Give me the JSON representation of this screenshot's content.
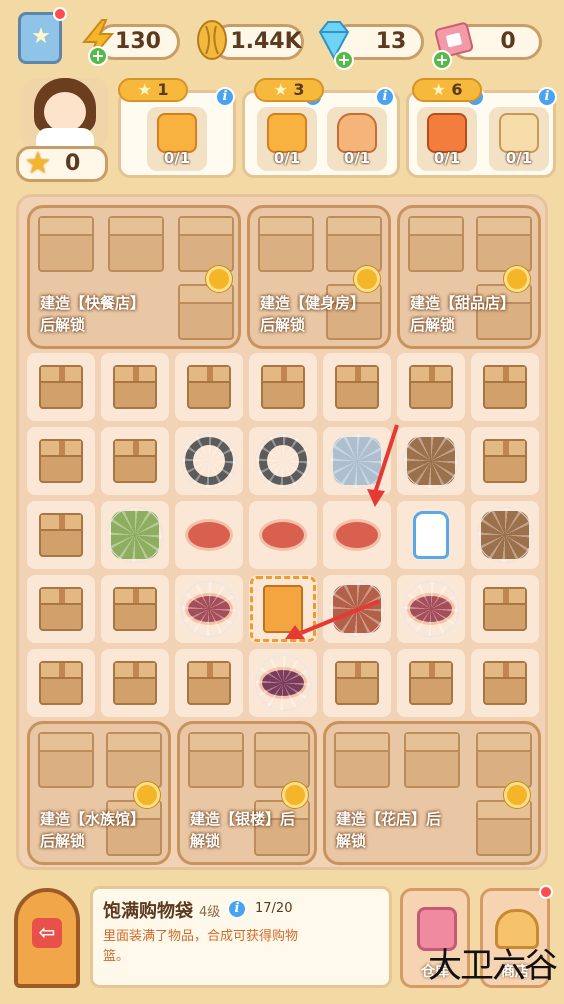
{
  "resources": {
    "energy": "130",
    "seeds": "1.44K",
    "gems": "13",
    "tickets": "0"
  },
  "player": {
    "level": "0"
  },
  "orders": [
    {
      "stars": "1",
      "items": [
        {
          "icon": "snack-bag-icon",
          "count": "0/1"
        }
      ]
    },
    {
      "stars": "3",
      "items": [
        {
          "icon": "snack-bag-icon",
          "count": "0/1"
        },
        {
          "icon": "jar-icon",
          "count": "0/1"
        }
      ]
    },
    {
      "stars": "6",
      "items": [
        {
          "icon": "gift-box-icon",
          "count": "0/1"
        },
        {
          "icon": "bread-icon",
          "count": "0/1"
        }
      ]
    }
  ],
  "locked_areas": {
    "top": [
      {
        "label_line1": "建造【快餐店】",
        "label_line2": "后解锁"
      },
      {
        "label_line1": "建造【健身房】",
        "label_line2": "后解锁"
      },
      {
        "label_line1": "建造【甜品店】",
        "label_line2": "后解锁"
      }
    ],
    "bottom": [
      {
        "label_line1": "建造【水族馆】",
        "label_line2": "后解锁"
      },
      {
        "label_line1": "建造【银楼】后",
        "label_line2": "解锁"
      },
      {
        "label_line1": "建造【花店】后",
        "label_line2": "解锁"
      }
    ]
  },
  "grid": [
    [
      "box",
      "box",
      "box",
      "box",
      "box",
      "box",
      "box"
    ],
    [
      "box",
      "box",
      "resistance-band",
      "resistance-band",
      "glass-jar",
      "sack",
      "box"
    ],
    [
      "box",
      "kimchi",
      "sunflower-seeds",
      "sunflower-seeds",
      "sunflower-seeds",
      "milk-bottle",
      "sack"
    ],
    [
      "box",
      "box",
      "seeds-plate",
      "shopping-bag",
      "jar",
      "seeds-plate",
      "box"
    ],
    [
      "box",
      "box",
      "box",
      "purple-plate",
      "box",
      "box",
      "box"
    ]
  ],
  "selected_item": {
    "name": "饱满购物袋",
    "level": "4级",
    "progress": "17/20",
    "description": "里面装满了物品，合成可获得购物篮。"
  },
  "shop_buttons": [
    {
      "label": "仓库",
      "icon": "storage-icon"
    },
    {
      "label": "商店",
      "icon": "store-icon"
    }
  ],
  "watermark": "大卫六谷",
  "colors": {
    "accent": "#f6b93b",
    "board": "#f1d2b4",
    "cell": "#fbe7d6",
    "arrow": "#e53935"
  }
}
